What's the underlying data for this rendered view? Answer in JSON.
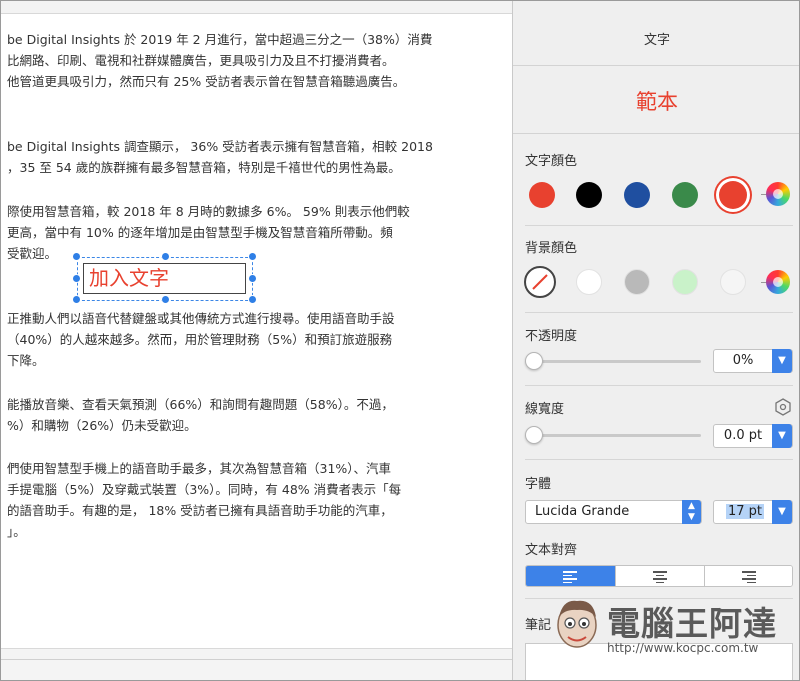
{
  "document": {
    "paragraphs": [
      [
        "be Digital Insights 於 2019 年 2 月進行，當中超過三分之一（38%）消費",
        "比網路、印刷、電視和社群媒體廣告，更具吸引力及且不打擾消費者。",
        "他管道更具吸引力，然而只有 25% 受訪者表示曾在智慧音箱聽過廣告。"
      ],
      [
        "be Digital Insights 調查顯示， 36% 受訪者表示擁有智慧音箱，相較 2018",
        "，35 至 54 歲的族群擁有最多智慧音箱，特別是千禧世代的男性為最。"
      ],
      [
        "際使用智慧音箱，較 2018 年 8 月時的數據多 6%。 59% 則表示他們較",
        "更高，當中有 10% 的逐年增加是由智慧型手機及智慧音箱所帶動。頻",
        "受歡迎。"
      ],
      [
        "正推動人們以語音代替鍵盤或其他傳統方式進行搜尋。使用語音助手設",
        "（40%）的人越來越多。然而，用於管理財務（5%）和預訂旅遊服務",
        "下降。"
      ],
      [
        "能播放音樂、查看天氣預測（66%）和詢問有趣問題（58%）。不過，",
        "%）和購物（26%）仍未受歡迎。"
      ],
      [
        "們使用智慧型手機上的語音助手最多，其次為智慧音箱（31%）、汽車",
        "手提電腦（5%）及穿戴式裝置（3%）。同時，有 48% 消費者表示「每",
        "的語音助手。有趣的是， 18% 受訪者已擁有具語音助手功能的汽車，",
        "」。"
      ]
    ],
    "textbox_text": "加入文字"
  },
  "panel": {
    "title": "文字",
    "sample": "範本",
    "text_color_label": "文字顏色",
    "background_color_label": "背景顏色",
    "opacity_label": "不透明度",
    "opacity_value": "0%",
    "opacity_fraction": 0,
    "line_width_label": "線寬度",
    "line_width_value": "0.0 pt",
    "line_width_fraction": 0,
    "font_label": "字體",
    "font_value": "Lucida Grande",
    "font_size_value": "17 pt",
    "alignment_label": "文本對齊",
    "alignment_selected": "left",
    "notes_label": "筆記"
  },
  "colors": {
    "text_swatches": [
      "#e8412f",
      "#000000",
      "#1f4fa0",
      "#3a8a4a",
      "#e8412f"
    ],
    "text_selected_index": 4,
    "background_swatches": [
      "none",
      "#ffffff",
      "#b9b9b9",
      "#c9f2c9",
      "#f5f5f5"
    ],
    "accent": "#3d82e8"
  },
  "watermark": {
    "title": "電腦王阿達",
    "url": "http://www.kocpc.com.tw"
  }
}
